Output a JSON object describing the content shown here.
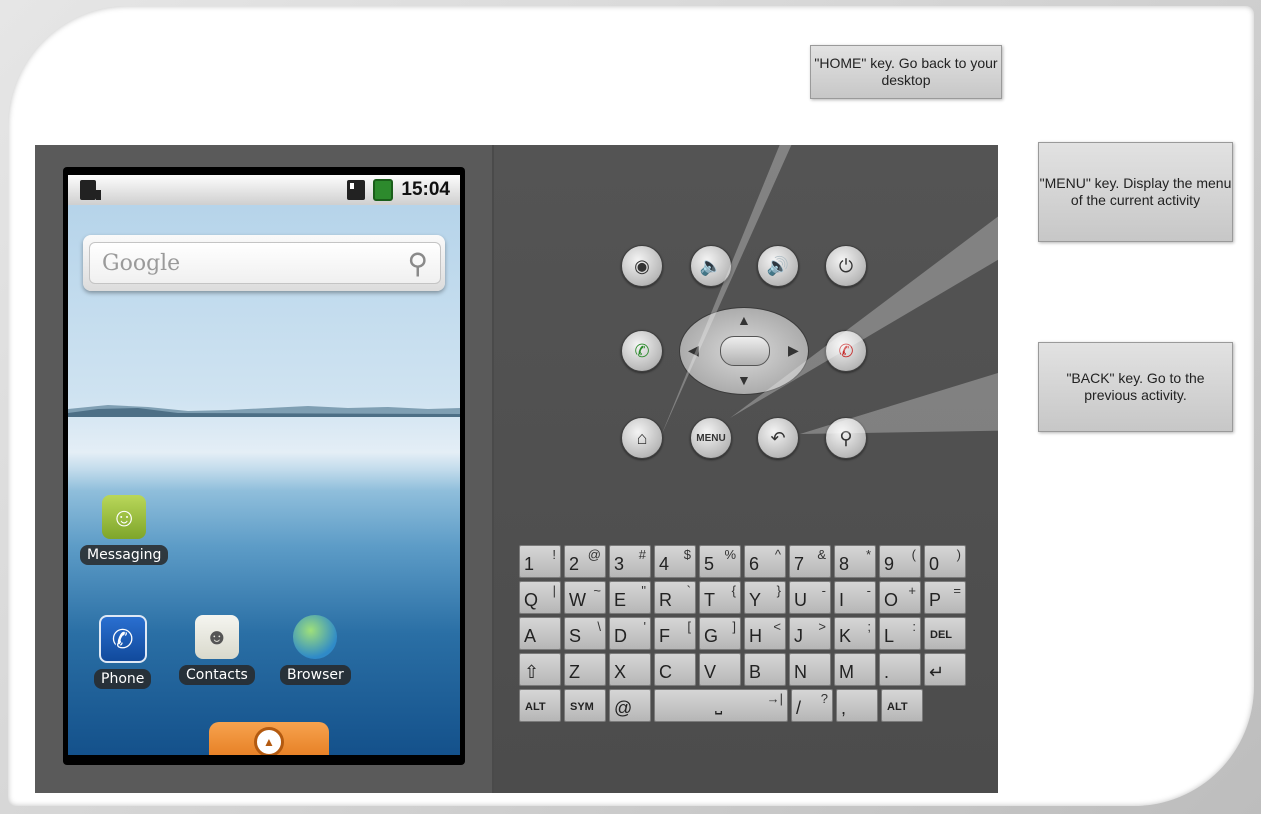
{
  "status_bar": {
    "time": "15:04"
  },
  "search_widget": {
    "placeholder": "Google"
  },
  "apps": {
    "messaging": "Messaging",
    "phone": "Phone",
    "contacts": "Contacts",
    "browser": "Browser"
  },
  "hardware_keys": {
    "menu_label": "MENU"
  },
  "keyboard": {
    "rows": [
      [
        [
          "1",
          "!"
        ],
        [
          "2",
          "@"
        ],
        [
          "3",
          "#"
        ],
        [
          "4",
          "$"
        ],
        [
          "5",
          "%"
        ],
        [
          "6",
          "^"
        ],
        [
          "7",
          "&"
        ],
        [
          "8",
          "*"
        ],
        [
          "9",
          "("
        ],
        [
          "0",
          ")"
        ]
      ],
      [
        [
          "Q",
          "|"
        ],
        [
          "W",
          "~"
        ],
        [
          "E",
          "\""
        ],
        [
          "R",
          "`"
        ],
        [
          "T",
          "{"
        ],
        [
          "Y",
          "}"
        ],
        [
          "U",
          "-"
        ],
        [
          "I",
          "-"
        ],
        [
          "O",
          "+"
        ],
        [
          "P",
          "="
        ]
      ],
      [
        [
          "A",
          ""
        ],
        [
          "S",
          "\\"
        ],
        [
          "D",
          "'"
        ],
        [
          "F",
          "["
        ],
        [
          "G",
          "]"
        ],
        [
          "H",
          "<"
        ],
        [
          "J",
          ">"
        ],
        [
          "K",
          ";"
        ],
        [
          "L",
          ":"
        ],
        [
          "DEL",
          ""
        ]
      ],
      [
        [
          "⇧",
          ""
        ],
        [
          "Z",
          ""
        ],
        [
          "X",
          ""
        ],
        [
          "C",
          ""
        ],
        [
          "V",
          ""
        ],
        [
          "B",
          ""
        ],
        [
          "N",
          ""
        ],
        [
          "M",
          ""
        ],
        [
          ".",
          ""
        ],
        [
          "↵",
          ""
        ]
      ]
    ],
    "bottom_row": {
      "alt_left": "ALT",
      "sym": "SYM",
      "at": "@",
      "space": "⎵",
      "tab": "→|",
      "slash": "/",
      "question": "?",
      "comma": ",",
      "alt_right": "ALT"
    }
  },
  "annotations": {
    "home": "\"HOME\" key. Go back to your desktop",
    "menu": "\"MENU\" key. Display the menu of the current activity",
    "back": "\"BACK\" key. Go to the previous activity."
  },
  "colors": {
    "drawer_orange": "#e47a1f",
    "emulator_gray": "#5d5d5d",
    "callout_gray": "#cfcfcf"
  }
}
